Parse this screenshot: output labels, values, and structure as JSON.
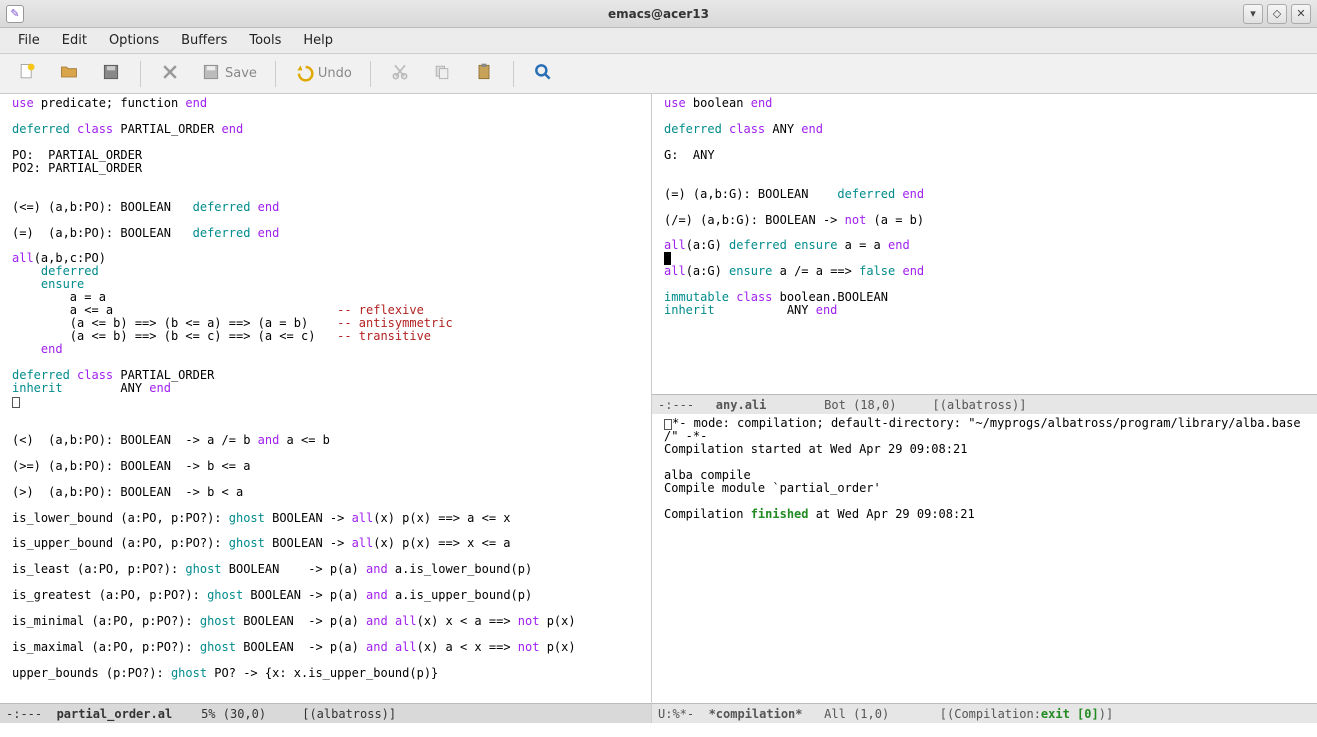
{
  "window": {
    "title": "emacs@acer13"
  },
  "menu": {
    "file": "File",
    "edit": "Edit",
    "options": "Options",
    "buffers": "Buffers",
    "tools": "Tools",
    "help": "Help"
  },
  "toolbar": {
    "save_label": "Save",
    "undo_label": "Undo"
  },
  "left": {
    "code": {
      "l1a": "use",
      "l1b": " predicate; function ",
      "l1c": "end",
      "l2a": "deferred",
      "l2b": " ",
      "l2c": "class",
      "l2d": " PARTIAL_ORDER ",
      "l2e": "end",
      "l3": "PO:  PARTIAL_ORDER",
      "l4": "PO2: PARTIAL_ORDER",
      "l5a": "(<=) (a,b:PO): BOOLEAN   ",
      "l5b": "deferred",
      "l5c": " ",
      "l5d": "end",
      "l6a": "(=)  (a,b:PO): BOOLEAN   ",
      "l6b": "deferred",
      "l6c": " ",
      "l6d": "end",
      "l7a": "all",
      "l7b": "(a,b,c:PO)",
      "l8a": "    ",
      "l8b": "deferred",
      "l9a": "    ",
      "l9b": "ensure",
      "l10": "        a = a",
      "l11a": "        a <= a                               ",
      "l11b": "-- reflexive",
      "l12a": "        (a <= b) ==> (b <= a) ==> (a = b)    ",
      "l12b": "-- antisymmetric",
      "l13a": "        (a <= b) ==> (b <= c) ==> (a <= c)   ",
      "l13b": "-- transitive",
      "l14a": "    ",
      "l14b": "end",
      "l15a": "deferred",
      "l15b": " ",
      "l15c": "class",
      "l15d": " PARTIAL_ORDER",
      "l16a": "inherit",
      "l16b": "        ANY ",
      "l16c": "end",
      "l17a": "(<)  (a,b:PO): BOOLEAN  -> a /= b ",
      "l17b": "and",
      "l17c": " a <= b",
      "l18": "(>=) (a,b:PO): BOOLEAN  -> b <= a",
      "l19": "(>)  (a,b:PO): BOOLEAN  -> b < a",
      "l20a": "is_lower_bound (a:PO, p:PO?): ",
      "l20b": "ghost",
      "l20c": " BOOLEAN -> ",
      "l20d": "all",
      "l20e": "(x) p(x) ==> a <= x",
      "l21a": "is_upper_bound (a:PO, p:PO?): ",
      "l21b": "ghost",
      "l21c": " BOOLEAN -> ",
      "l21d": "all",
      "l21e": "(x) p(x) ==> x <= a",
      "l22a": "is_least (a:PO, p:PO?): ",
      "l22b": "ghost",
      "l22c": " BOOLEAN    -> p(a) ",
      "l22d": "and",
      "l22e": " a.is_lower_bound(p)",
      "l23a": "is_greatest (a:PO, p:PO?): ",
      "l23b": "ghost",
      "l23c": " BOOLEAN -> p(a) ",
      "l23d": "and",
      "l23e": " a.is_upper_bound(p)",
      "l24a": "is_minimal (a:PO, p:PO?): ",
      "l24b": "ghost",
      "l24c": " BOOLEAN  -> p(a) ",
      "l24d": "and",
      "l24e": " ",
      "l24f": "all",
      "l24g": "(x) x < a ==> ",
      "l24h": "not",
      "l24i": " p(x)",
      "l25a": "is_maximal (a:PO, p:PO?): ",
      "l25b": "ghost",
      "l25c": " BOOLEAN  -> p(a) ",
      "l25d": "and",
      "l25e": " ",
      "l25f": "all",
      "l25g": "(x) a < x ==> ",
      "l25h": "not",
      "l25i": " p(x)",
      "l26a": "upper_bounds (p:PO?): ",
      "l26b": "ghost",
      "l26c": " PO? -> {x: x.is_upper_bound(p)}"
    },
    "modeline": {
      "status": "-:---  ",
      "buffer": "partial_order.al",
      "pos": "    5% (30,0)     [(albatross)]"
    }
  },
  "right_top": {
    "code": {
      "l1a": "use",
      "l1b": " boolean ",
      "l1c": "end",
      "l2a": "deferred",
      "l2b": " ",
      "l2c": "class",
      "l2d": " ANY ",
      "l2e": "end",
      "l3": "G:  ANY",
      "l4a": "(=) (a,b:G): BOOLEAN    ",
      "l4b": "deferred",
      "l4c": " ",
      "l4d": "end",
      "l5a": "(/=) (a,b:G): BOOLEAN -> ",
      "l5b": "not",
      "l5c": " (a = b)",
      "l6a": "all",
      "l6b": "(a:G) ",
      "l6c": "deferred",
      "l6d": " ",
      "l6e": "ensure",
      "l6f": " a = a ",
      "l6g": "end",
      "l7a": "all",
      "l7b": "(a:G) ",
      "l7c": "ensure",
      "l7d": " a /= a ==> ",
      "l7e": "false",
      "l7f": " ",
      "l7g": "end",
      "l8a": "immutable",
      "l8b": " ",
      "l8c": "class",
      "l8d": " boolean.BOOLEAN",
      "l9a": "inherit",
      "l9b": "          ANY ",
      "l9c": "end"
    },
    "modeline": {
      "status": "-:---   ",
      "buffer": "any.ali",
      "pos": "        Bot (18,0)     [(albatross)]"
    }
  },
  "right_bot": {
    "code": {
      "l1a": "*- mode: compilation; default-directory: \"~/myprogs/albatross/program/library/alba.base",
      "l1b": "/\" -*-",
      "l2": "Compilation started at Wed Apr 29 09:08:21",
      "l3": "alba compile",
      "l4": "Compile module `partial_order'",
      "l5a": "Compilation ",
      "l5b": "finished",
      "l5c": " at Wed Apr 29 09:08:21"
    },
    "modeline": {
      "status": "U:%*-  ",
      "buffer": "*compilation*",
      "pos": "   All (1,0)       [(Compilation:",
      "exit": "exit [0]",
      "tail": ")]"
    }
  }
}
